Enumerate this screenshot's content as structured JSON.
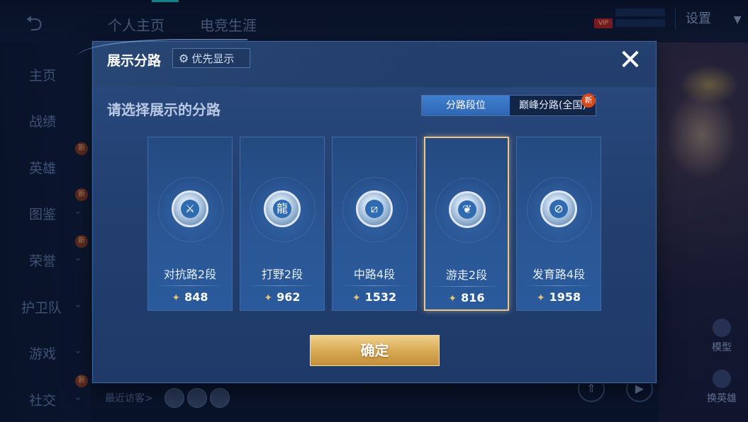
{
  "top_bar": {
    "tabs": [
      "个人主页",
      "电竞生涯"
    ],
    "settings_label": "设置",
    "vip_badge": "VIP"
  },
  "sidebar": {
    "items": [
      {
        "label": "主页",
        "chevron": false,
        "new": false
      },
      {
        "label": "战绩",
        "chevron": false,
        "new": false
      },
      {
        "label": "英雄",
        "chevron": false,
        "new": true
      },
      {
        "label": "图鉴",
        "chevron": true,
        "new": true
      },
      {
        "label": "荣誉",
        "chevron": true,
        "new": true
      },
      {
        "label": "护卫队",
        "chevron": true,
        "new": false
      },
      {
        "label": "游戏",
        "chevron": true,
        "new": false
      },
      {
        "label": "社交",
        "chevron": true,
        "new": true
      }
    ],
    "new_tag": "新"
  },
  "right_panel": {
    "model_label": "模型",
    "switch_hero_label": "换英雄"
  },
  "footer": {
    "visitors_label": "最近访客>"
  },
  "dialog": {
    "title": "展示分路",
    "priority_label": "优先显示",
    "close_glyph": "✕",
    "subtitle": "请选择展示的分路",
    "segments": {
      "active": "分路段位",
      "inactive": "巅峰分路(全国)",
      "new_tag": "新"
    },
    "lanes": [
      {
        "label": "对抗路2段",
        "score": "848",
        "icon": "sword-icon",
        "selected": false
      },
      {
        "label": "打野2段",
        "score": "962",
        "icon": "dragon-icon",
        "selected": false
      },
      {
        "label": "中路4段",
        "score": "1532",
        "icon": "mid-lane-icon",
        "selected": false
      },
      {
        "label": "游走2段",
        "score": "816",
        "icon": "wings-icon",
        "selected": true
      },
      {
        "label": "发育路4段",
        "score": "1958",
        "icon": "target-icon",
        "selected": false
      }
    ],
    "confirm_label": "确定"
  },
  "colors": {
    "accent_gold": "#e8c68a",
    "segment_active": "#3f7fd0",
    "new_badge": "#d44a1e"
  }
}
